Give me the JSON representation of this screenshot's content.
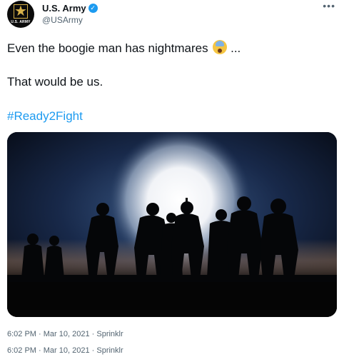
{
  "account": {
    "display_name": "U.S. Army",
    "handle": "@USArmy",
    "avatar_label": "U.S. ARMY",
    "verified": true
  },
  "menu": {
    "more_label": "•••"
  },
  "tweet": {
    "line1": "Even the boogie man has nightmares",
    "line1_suffix": " ...",
    "emoji_name": "face-screaming-in-fear-icon",
    "line2": "That would be us.",
    "hashtag": "#Ready2Fight"
  },
  "media": {
    "description_icon": "soldiers-silhouette-photo",
    "glow_color": "#ffffff",
    "sky_color": "#1e3255"
  },
  "meta": {
    "time": "6:02 PM",
    "separator": " · ",
    "date": "Mar 10, 2021",
    "source": "Sprinklr"
  },
  "colors": {
    "accent": "#1d9bf0",
    "secondary_text": "#536471",
    "primary_text": "#0f1419"
  }
}
